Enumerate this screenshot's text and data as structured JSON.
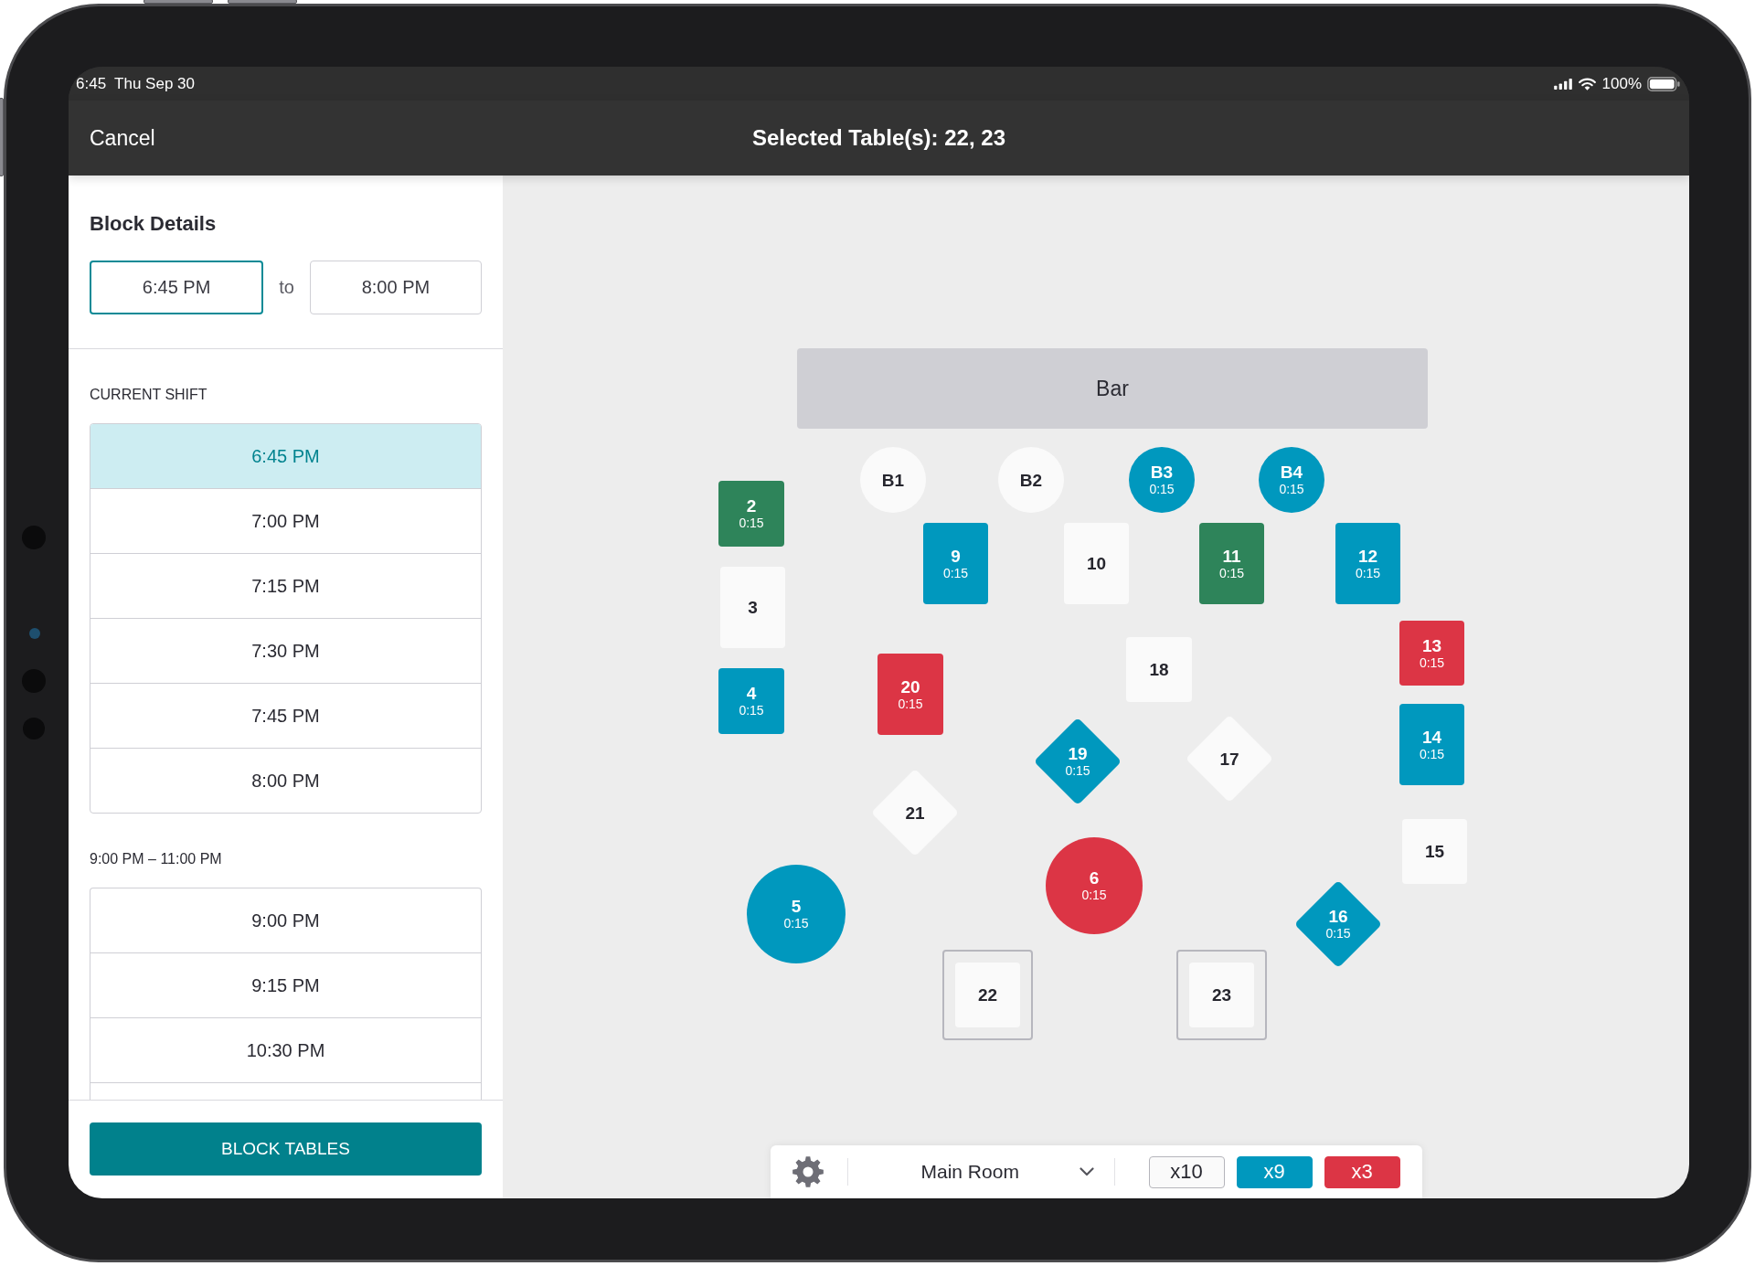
{
  "status_bar": {
    "time": "6:45",
    "date": "Thu Sep 30",
    "battery": "100%"
  },
  "header": {
    "cancel": "Cancel",
    "title": "Selected Table(s): 22, 23"
  },
  "block_details": {
    "title": "Block Details",
    "time_fields": [
      {
        "value": "6:45 PM",
        "focused": true
      },
      {
        "value": "8:00 PM",
        "focused": false
      }
    ],
    "separator": "to"
  },
  "shifts": [
    {
      "title": "CURRENT SHIFT",
      "times": [
        {
          "label": "6:45 PM",
          "selected": true
        },
        {
          "label": "7:00 PM",
          "selected": false
        },
        {
          "label": "7:15 PM",
          "selected": false
        },
        {
          "label": "7:30 PM",
          "selected": false
        },
        {
          "label": "7:45 PM",
          "selected": false
        },
        {
          "label": "8:00 PM",
          "selected": false
        }
      ]
    },
    {
      "title": "9:00 PM – 11:00 PM",
      "times": [
        {
          "label": "9:00 PM",
          "selected": false
        },
        {
          "label": "9:15 PM",
          "selected": false
        },
        {
          "label": "10:30 PM",
          "selected": false
        }
      ]
    }
  ],
  "block_button": "BLOCK TABLES",
  "floor": {
    "bar_label": "Bar",
    "tables": [
      {
        "number": "B1",
        "kind": "round",
        "color": "#fafafa",
        "selected": false
      },
      {
        "number": "B2",
        "kind": "round",
        "color": "#fafafa",
        "selected": false
      },
      {
        "number": "B3",
        "time": "0:15",
        "kind": "round",
        "color": "#0098be",
        "selected": false
      },
      {
        "number": "B4",
        "time": "0:15",
        "kind": "round",
        "color": "#0098be",
        "selected": false
      },
      {
        "number": "2",
        "time": "0:15",
        "kind": "square",
        "color": "#2e845a",
        "selected": false
      },
      {
        "number": "9",
        "time": "0:15",
        "kind": "square",
        "color": "#0098be",
        "selected": false
      },
      {
        "number": "10",
        "kind": "square",
        "color": "#fafafa",
        "selected": false
      },
      {
        "number": "11",
        "time": "0:15",
        "kind": "square",
        "color": "#2e845a",
        "selected": false
      },
      {
        "number": "12",
        "time": "0:15",
        "kind": "square",
        "color": "#0098be",
        "selected": false
      },
      {
        "number": "3",
        "kind": "square",
        "color": "#fafafa",
        "selected": false
      },
      {
        "number": "13",
        "time": "0:15",
        "kind": "square",
        "color": "#dc3545",
        "selected": false
      },
      {
        "number": "18",
        "kind": "square",
        "color": "#fafafa",
        "selected": false
      },
      {
        "number": "20",
        "time": "0:15",
        "kind": "square",
        "color": "#dc3545",
        "selected": false
      },
      {
        "number": "4",
        "time": "0:15",
        "kind": "square",
        "color": "#0098be",
        "selected": false
      },
      {
        "number": "14",
        "time": "0:15",
        "kind": "square",
        "color": "#0098be",
        "selected": false
      },
      {
        "number": "19",
        "time": "0:15",
        "kind": "diamond",
        "color": "#0098be",
        "selected": false
      },
      {
        "number": "17",
        "kind": "diamond",
        "color": "#fafafa",
        "selected": false
      },
      {
        "number": "21",
        "kind": "diamond",
        "color": "#fafafa",
        "selected": false
      },
      {
        "number": "15",
        "kind": "square",
        "color": "#fafafa",
        "selected": false
      },
      {
        "number": "6",
        "time": "0:15",
        "kind": "round",
        "color": "#dc3545",
        "selected": false
      },
      {
        "number": "5",
        "time": "0:15",
        "kind": "round",
        "color": "#0098be",
        "selected": false
      },
      {
        "number": "16",
        "time": "0:15",
        "kind": "diamond",
        "color": "#0098be",
        "selected": false
      },
      {
        "number": "22",
        "kind": "square",
        "color": "#fafafa",
        "selected": true
      },
      {
        "number": "23",
        "kind": "square",
        "color": "#fafafa",
        "selected": true
      }
    ]
  },
  "toolbar": {
    "room": "Main Room",
    "counts": [
      {
        "label": "x10",
        "color": "#fafafa"
      },
      {
        "label": "x9",
        "color": "#0098be"
      },
      {
        "label": "x3",
        "color": "#dc3545"
      }
    ]
  }
}
